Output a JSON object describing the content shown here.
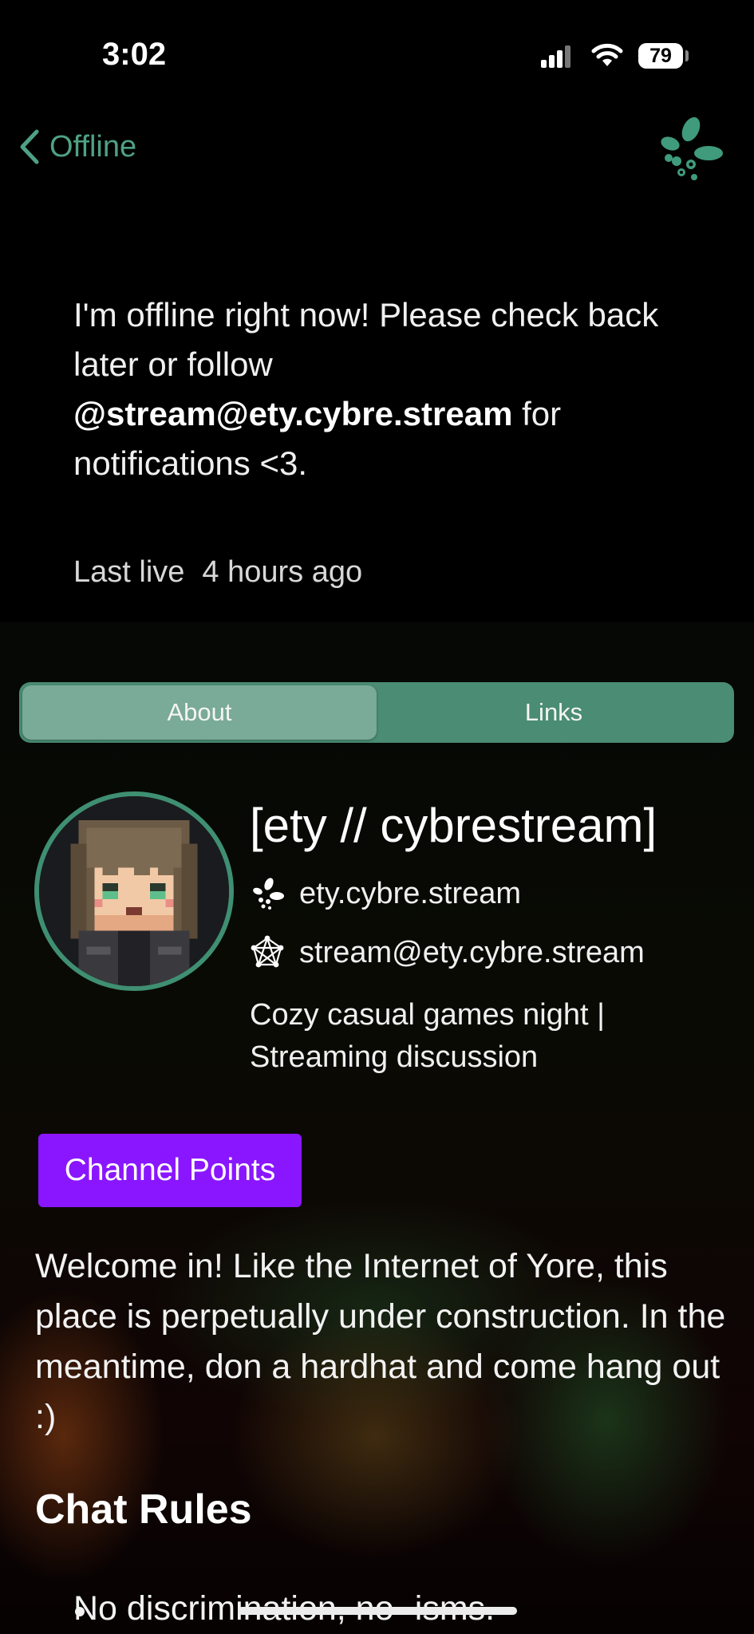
{
  "status_bar": {
    "time": "3:02",
    "battery": "79"
  },
  "nav": {
    "back_label": "Offline",
    "accent_color": "#4fa184"
  },
  "offline": {
    "line1": "I'm offline right now! Please check back later or follow ",
    "handle": "@stream@ety.cybre.stream",
    "line2": " for notifications <3.",
    "last_live_label": "Last live",
    "last_live_value": "4 hours ago"
  },
  "tabs": [
    {
      "label": "About",
      "active": true
    },
    {
      "label": "Links",
      "active": false
    }
  ],
  "profile": {
    "name": "[ety // cybrestream]",
    "domain": "ety.cybre.stream",
    "fediverse": "stream@ety.cybre.stream",
    "description": "Cozy casual games night | Streaming discussion"
  },
  "channel_points_label": "Channel Points",
  "channel_points_color": "#8a16ff",
  "about": {
    "welcome": "Welcome in! Like the Internet of Yore, this place is perpetually under construction. In the meantime, don a hardhat and come hang out :)",
    "rules_title": "Chat Rules",
    "rules": [
      "No discrimination, no -isms."
    ]
  },
  "icons": {
    "back": "chevron-left-icon",
    "logo": "owncast-logo-icon",
    "domain": "owncast-icon",
    "fediverse": "fediverse-pentagram-icon"
  }
}
